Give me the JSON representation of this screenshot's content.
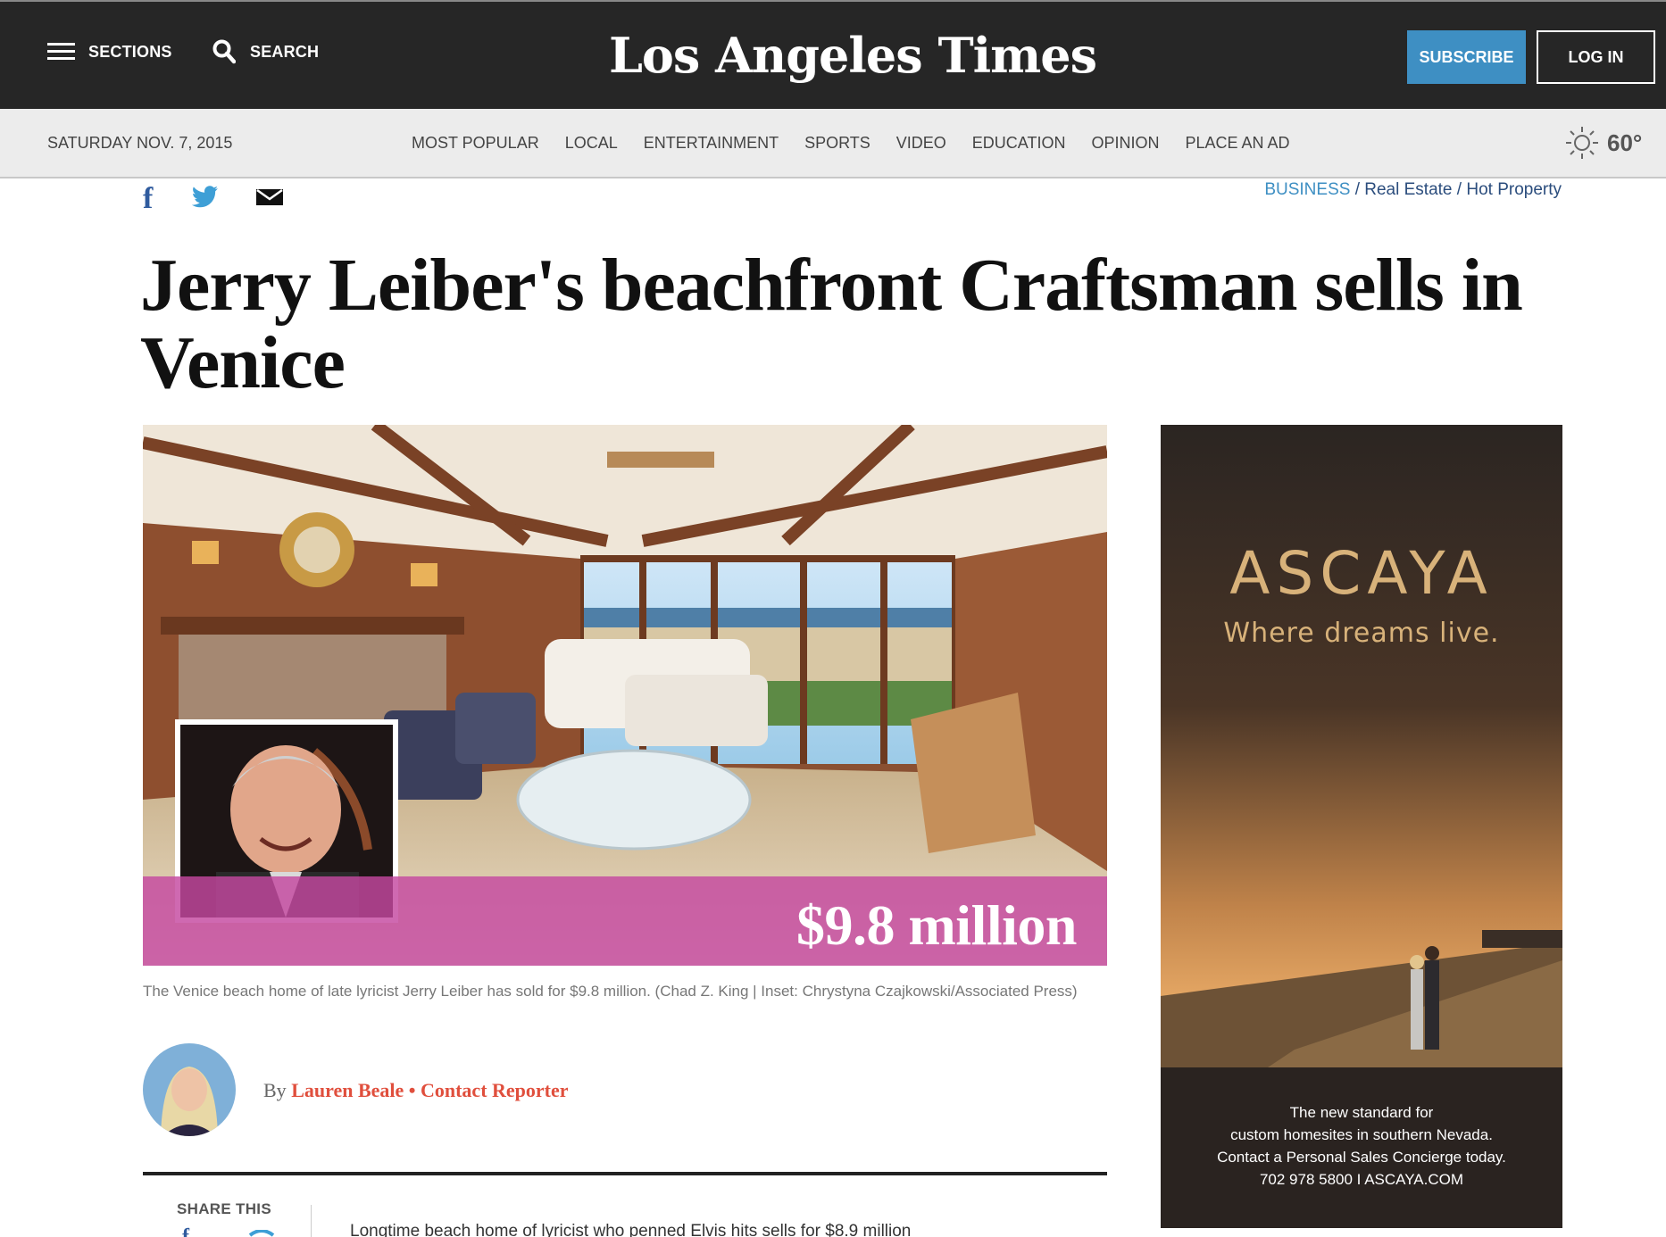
{
  "header": {
    "sections_label": "SECTIONS",
    "search_label": "SEARCH",
    "masthead": "Los Angeles Times",
    "subscribe_label": "SUBSCRIBE",
    "login_label": "LOG IN"
  },
  "nav": {
    "date": "SATURDAY NOV. 7, 2015",
    "items": [
      "MOST POPULAR",
      "LOCAL",
      "ENTERTAINMENT",
      "SPORTS",
      "VIDEO",
      "EDUCATION",
      "OPINION",
      "PLACE AN AD"
    ],
    "weather_temp": "60°",
    "weather_icon": "sun-icon"
  },
  "article": {
    "breadcrumb": {
      "section": "BUSINESS",
      "sep1": " / ",
      "sub1": "Real Estate",
      "sep2": " / ",
      "sub2": "Hot Property"
    },
    "headline": "Jerry Leiber's beachfront Craftsman sells in Venice",
    "price_overlay": "$9.8 million",
    "caption": "The Venice beach home of late lyricist Jerry Leiber has sold for $9.8 million. (Chad Z. King | Inset: Chrystyna Czajkowski/Associated Press)",
    "byline_prefix": "By ",
    "author": "Lauren Beale",
    "byline_dot": " • ",
    "contact_label": "Contact Reporter",
    "share_this_label": "SHARE THIS",
    "summary": "Longtime beach home of lyricist who penned Elvis hits sells for $8.9 million"
  },
  "ad": {
    "brand": "ASCAYA",
    "tagline": "Where dreams live.",
    "copy_lines": [
      "The new standard for",
      "custom homesites in southern Nevada.",
      "Contact a Personal Sales Concierge today.",
      "702 978 5800 I ASCAYA.COM"
    ]
  },
  "colors": {
    "topbar": "#262626",
    "subscribe": "#3e8fc3",
    "link_red": "#e04f3d",
    "price_band": "#c448a0",
    "ad_gold": "#d8b27a"
  }
}
